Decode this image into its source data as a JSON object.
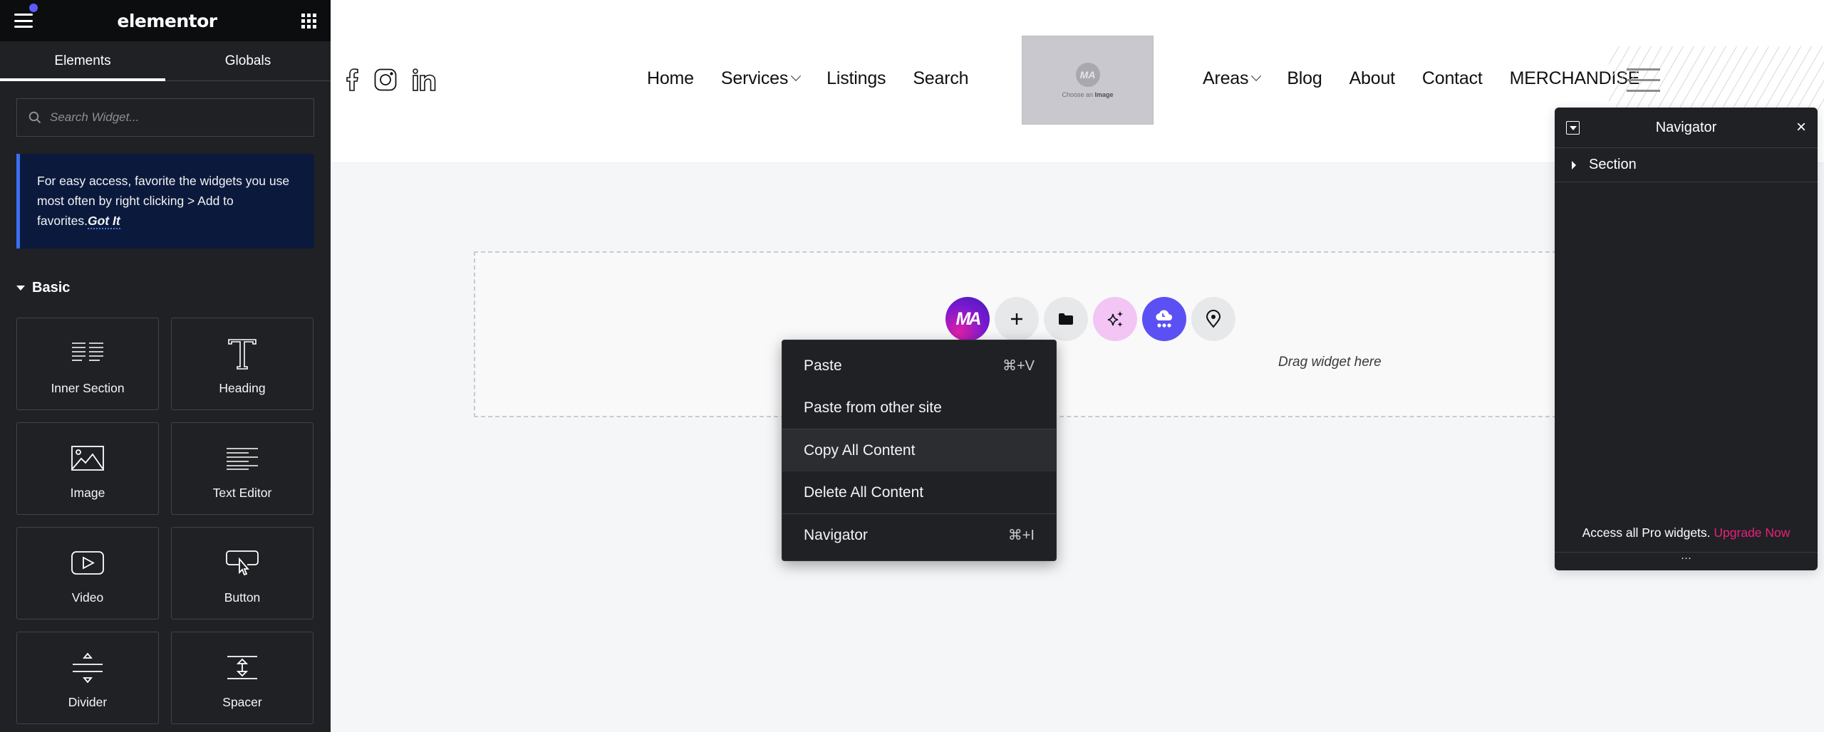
{
  "sidebar": {
    "logo": "elementor",
    "tabs": [
      {
        "label": "Elements",
        "active": true
      },
      {
        "label": "Globals",
        "active": false
      }
    ],
    "search": {
      "placeholder": "Search Widget...",
      "value": ""
    },
    "notice": {
      "text": "For easy access, favorite the widgets you use most often by right clicking > Add to favorites.",
      "link": "Got It"
    },
    "category": "Basic",
    "widgets": [
      {
        "label": "Inner Section",
        "icon": "inner-section-icon"
      },
      {
        "label": "Heading",
        "icon": "heading-icon"
      },
      {
        "label": "Image",
        "icon": "image-icon"
      },
      {
        "label": "Text Editor",
        "icon": "text-editor-icon"
      },
      {
        "label": "Video",
        "icon": "video-icon"
      },
      {
        "label": "Button",
        "icon": "button-icon"
      },
      {
        "label": "Divider",
        "icon": "divider-icon"
      },
      {
        "label": "Spacer",
        "icon": "spacer-icon"
      }
    ]
  },
  "header": {
    "social": [
      "facebook-icon",
      "instagram-icon",
      "linkedin-icon"
    ],
    "nav_left": [
      {
        "label": "Home",
        "dropdown": false
      },
      {
        "label": "Services",
        "dropdown": true
      },
      {
        "label": "Listings",
        "dropdown": false
      },
      {
        "label": "Search",
        "dropdown": false
      }
    ],
    "logo_placeholder": {
      "mark": "MA",
      "caption_prefix": "Choose an",
      "caption_bold": "Image"
    },
    "nav_right": [
      {
        "label": "Areas",
        "dropdown": true
      },
      {
        "label": "Blog",
        "dropdown": false
      },
      {
        "label": "About",
        "dropdown": false
      },
      {
        "label": "Contact",
        "dropdown": false
      },
      {
        "label": "MERCHANDISE",
        "dropdown": false
      }
    ]
  },
  "canvas": {
    "drop_text": "Drag widget here",
    "tools": [
      {
        "name": "ma-addon",
        "label": "MA"
      },
      {
        "name": "add-section",
        "icon": "plus-icon"
      },
      {
        "name": "template-library",
        "icon": "folder-icon"
      },
      {
        "name": "ai-generate",
        "icon": "sparkle-icon"
      },
      {
        "name": "cloud-templates",
        "icon": "cloud-icon"
      },
      {
        "name": "site-location",
        "icon": "location-pin-icon"
      }
    ]
  },
  "context_menu": {
    "items": [
      {
        "label": "Paste",
        "shortcut": "⌘+V"
      },
      {
        "label": "Paste from other site",
        "shortcut": ""
      },
      {
        "label": "Copy All Content",
        "shortcut": "",
        "highlighted": true
      },
      {
        "label": "Delete All Content",
        "shortcut": ""
      },
      {
        "label": "Navigator",
        "shortcut": "⌘+I"
      }
    ]
  },
  "navigator": {
    "title": "Navigator",
    "close": "×",
    "tree": [
      {
        "label": "Section"
      }
    ],
    "promo_text": "Access all Pro widgets.",
    "promo_link": "Upgrade Now",
    "footer": "···"
  },
  "colors": {
    "sidebar_bg": "#1f2124",
    "topbar_bg": "#0c0d0e",
    "accent_blue": "#5b5bf7",
    "notice_bg": "#0b1a3c",
    "upgrade_pink": "#e9217a",
    "cloud_purple": "#5b50f3",
    "ai_pink": "#f2c5f5"
  }
}
